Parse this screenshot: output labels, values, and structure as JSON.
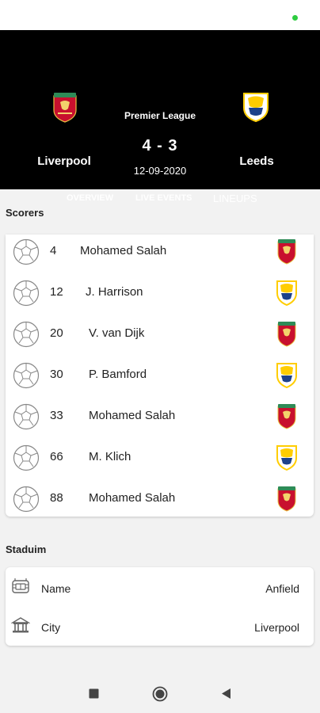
{
  "match": {
    "league": "Premier League",
    "score": "4 - 3",
    "date": "12-09-2020",
    "home_team": "Liverpool",
    "away_team": "Leeds"
  },
  "tabs": {
    "overview": "OVERVIEW",
    "live_events": "LIVE EVENTS",
    "lineups": "LINEUPS"
  },
  "scorers": {
    "title": "Scorers",
    "items": [
      {
        "minute": "4",
        "player": "Mohamed Salah",
        "team": "liverpool"
      },
      {
        "minute": "12",
        "player": "J. Harrison",
        "team": "leeds"
      },
      {
        "minute": "20",
        "player": "V. van Dijk",
        "team": "liverpool"
      },
      {
        "minute": "30",
        "player": "P. Bamford",
        "team": "leeds"
      },
      {
        "minute": "33",
        "player": "Mohamed Salah",
        "team": "liverpool"
      },
      {
        "minute": "66",
        "player": "M. Klich",
        "team": "leeds"
      },
      {
        "minute": "88",
        "player": "Mohamed Salah",
        "team": "liverpool"
      }
    ]
  },
  "stadium": {
    "title": "Staduim",
    "name_label": "Name",
    "name_value": "Anfield",
    "city_label": "City",
    "city_value": "Liverpool"
  },
  "colors": {
    "header_bg": "#000000",
    "liverpool_red": "#c8102e",
    "leeds_yellow": "#ffcd00",
    "leeds_blue": "#1d428a",
    "status_dot": "#2ecc40"
  }
}
